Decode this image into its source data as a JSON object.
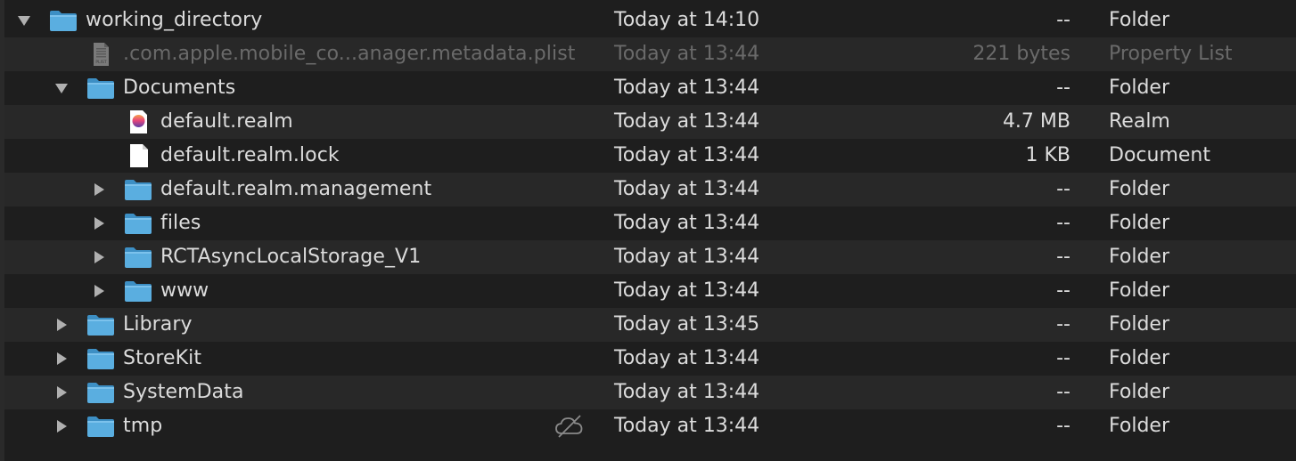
{
  "rows": [
    {
      "name": "working_directory",
      "date": "Today at 14:10",
      "size": "--",
      "kind": "Folder",
      "icon": "folder-icon",
      "disclosure": "expanded",
      "level": 0
    },
    {
      "name": ".com.apple.mobile_co...anager.metadata.plist",
      "date": "Today at 13:44",
      "size": "221 bytes",
      "kind": "Property List",
      "icon": "plist-file-icon",
      "disclosure": "none",
      "level": 1,
      "dim": true
    },
    {
      "name": "Documents",
      "date": "Today at 13:44",
      "size": "--",
      "kind": "Folder",
      "icon": "folder-icon",
      "disclosure": "expanded",
      "level": 1
    },
    {
      "name": "default.realm",
      "date": "Today at 13:44",
      "size": "4.7 MB",
      "kind": "Realm",
      "icon": "realm-file-icon",
      "disclosure": "none",
      "level": 2
    },
    {
      "name": "default.realm.lock",
      "date": "Today at 13:44",
      "size": "1 KB",
      "kind": "Document",
      "icon": "document-icon",
      "disclosure": "none",
      "level": 2
    },
    {
      "name": "default.realm.management",
      "date": "Today at 13:44",
      "size": "--",
      "kind": "Folder",
      "icon": "folder-icon",
      "disclosure": "collapsed",
      "level": 2
    },
    {
      "name": "files",
      "date": "Today at 13:44",
      "size": "--",
      "kind": "Folder",
      "icon": "folder-icon",
      "disclosure": "collapsed",
      "level": 2
    },
    {
      "name": "RCTAsyncLocalStorage_V1",
      "date": "Today at 13:44",
      "size": "--",
      "kind": "Folder",
      "icon": "folder-icon",
      "disclosure": "collapsed",
      "level": 2
    },
    {
      "name": "www",
      "date": "Today at 13:44",
      "size": "--",
      "kind": "Folder",
      "icon": "folder-icon",
      "disclosure": "collapsed",
      "level": 2
    },
    {
      "name": "Library",
      "date": "Today at 13:45",
      "size": "--",
      "kind": "Folder",
      "icon": "folder-icon",
      "disclosure": "collapsed",
      "level": 1
    },
    {
      "name": "StoreKit",
      "date": "Today at 13:44",
      "size": "--",
      "kind": "Folder",
      "icon": "folder-icon",
      "disclosure": "collapsed",
      "level": 1
    },
    {
      "name": "SystemData",
      "date": "Today at 13:44",
      "size": "--",
      "kind": "Folder",
      "icon": "folder-icon",
      "disclosure": "collapsed",
      "level": 1
    },
    {
      "name": "tmp",
      "date": "Today at 13:44",
      "size": "--",
      "kind": "Folder",
      "icon": "folder-icon",
      "disclosure": "collapsed",
      "level": 1,
      "status_icon": "icloud-excluded-icon"
    }
  ],
  "colors": {
    "folder_blue": "#5aaee0",
    "row_alt": "#282828",
    "background": "#1e1e1e",
    "text": "#dcdcdc",
    "dim_text": "#6a6a6a"
  }
}
